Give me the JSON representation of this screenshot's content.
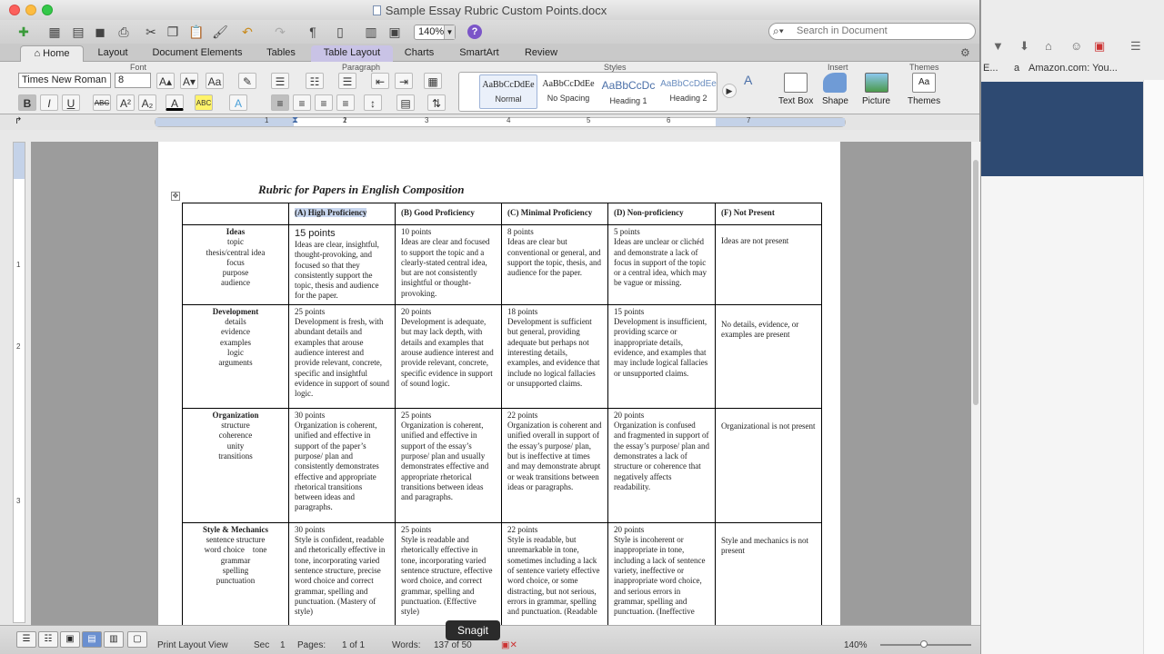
{
  "window": {
    "title": "Sample Essay Rubric Custom Points.docx"
  },
  "toolbar": {
    "zoom": "140%",
    "search_placeholder": "Search in Document"
  },
  "tabs": [
    "Home",
    "Layout",
    "Document Elements",
    "Tables",
    "Table Layout",
    "Charts",
    "SmartArt",
    "Review"
  ],
  "ribbon": {
    "groups": {
      "font": "Font",
      "paragraph": "Paragraph",
      "styles": "Styles",
      "insert": "Insert",
      "themes": "Themes"
    },
    "font_name": "Times New Roman",
    "font_size": "8",
    "styles": [
      {
        "preview": "AaBbCcDdEe",
        "name": "Normal"
      },
      {
        "preview": "AaBbCcDdEe",
        "name": "No Spacing"
      },
      {
        "preview": "AaBbCcDc",
        "name": "Heading 1"
      },
      {
        "preview": "AaBbCcDdEe",
        "name": "Heading 2"
      }
    ],
    "insert_items": [
      "Text Box",
      "Shape",
      "Picture"
    ],
    "themes_label": "Themes"
  },
  "ruler": {
    "numbers": [
      "1",
      "1",
      "2",
      "3",
      "4",
      "5",
      "6",
      "7"
    ],
    "vnumbers": [
      "1",
      "2",
      "3"
    ]
  },
  "browser": {
    "bookmark": "E...",
    "amazon": "Amazon.com: You..."
  },
  "document": {
    "title": "Rubric for Papers in English Composition",
    "headers": [
      "",
      "(A) High Proficiency",
      "(B) Good Proficiency",
      "(C) Minimal Proficiency",
      "(D) Non-proficiency",
      "(F) Not Present"
    ],
    "rows": [
      {
        "criterion": "Ideas",
        "subs": [
          "topic",
          "thesis/central idea",
          "focus",
          "purpose",
          "audience"
        ],
        "cells": [
          {
            "points": "15 points",
            "text": "Ideas are clear, insightful, thought-provoking, and focused so that they consistently support the topic, thesis and audience for the paper."
          },
          {
            "points": "10 points",
            "text": "Ideas are clear and focused to support the topic and a clearly-stated central idea, but are not consistently insightful or thought-provoking."
          },
          {
            "points": "8 points",
            "text": "Ideas are clear but conventional or general, and support the topic, thesis, and audience for the paper."
          },
          {
            "points": "5 points",
            "text": "Ideas are unclear or clichéd and demonstrate a lack of focus in support of the topic or a central idea, which may be vague or missing."
          },
          {
            "points": "",
            "text": "Ideas are not present"
          }
        ]
      },
      {
        "criterion": "Development",
        "subs": [
          "details",
          "evidence",
          "examples",
          "logic",
          "arguments"
        ],
        "cells": [
          {
            "points": "25 points",
            "text": "Development is fresh, with abundant details and examples that arouse audience interest and provide relevant, concrete, specific and insightful evidence in support of sound logic."
          },
          {
            "points": "20 points",
            "text": "Development is adequate, but may lack depth, with details and examples that arouse audience interest and provide relevant, concrete, specific evidence in support of sound logic."
          },
          {
            "points": "18 points",
            "text": "Development is sufficient but general, providing adequate but perhaps not interesting details, examples, and evidence that include no logical fallacies or unsupported claims."
          },
          {
            "points": "15 points",
            "text": "Development is insufficient, providing scarce or inappropriate details, evidence, and examples that may include logical fallacies or unsupported claims."
          },
          {
            "points": "",
            "text": "No details, evidence, or examples are present"
          }
        ]
      },
      {
        "criterion": "Organization",
        "subs": [
          "structure",
          "coherence",
          "unity",
          "transitions"
        ],
        "cells": [
          {
            "points": "30 points",
            "text": "Organization is coherent, unified and effective in support of the paper’s purpose/ plan and consistently demonstrates effective and appropriate rhetorical transitions between ideas and paragraphs."
          },
          {
            "points": "25 points",
            "text": "Organization is coherent, unified and effective in support of the essay’s purpose/ plan and usually demonstrates effective and appropriate rhetorical transitions between ideas and paragraphs."
          },
          {
            "points": "22 points",
            "text": "Organization is coherent and unified overall in support of the essay’s purpose/ plan, but is ineffective at times and may demonstrate abrupt or weak transitions between ideas or paragraphs."
          },
          {
            "points": "20 points",
            "text": "Organization is confused and fragmented in support of the essay’s purpose/ plan and demonstrates a lack of structure or coherence that negatively affects readability."
          },
          {
            "points": "",
            "text": "Organizational is not present"
          }
        ]
      },
      {
        "criterion": "Style & Mechanics",
        "subs": [
          "sentence structure",
          "word choice    tone",
          "grammar",
          "spelling",
          "punctuation"
        ],
        "cells": [
          {
            "points": "30 points",
            "text": "Style is confident, readable and rhetorically effective in tone, incorporating varied sentence structure, precise word choice and correct grammar, spelling and punctuation. (Mastery of style)"
          },
          {
            "points": "25 points",
            "text": "Style is readable and rhetorically effective in tone, incorporating varied sentence structure, effective word choice, and correct grammar, spelling and punctuation. (Effective style)"
          },
          {
            "points": "22 points",
            "text": "Style is readable, but unremarkable in tone, sometimes including a lack of sentence variety effective word choice, or some distracting, but not serious, errors in grammar, spelling and punctuation. (Readable"
          },
          {
            "points": "20 points",
            "text": "Style is incoherent or inappropriate in tone, including a lack of sentence variety, ineffective or inappropriate word choice, and serious errors in grammar, spelling and punctuation. (Ineffective"
          },
          {
            "points": "",
            "text": "Style and mechanics is not present"
          }
        ]
      }
    ]
  },
  "status": {
    "view": "Print Layout View",
    "sec_label": "Sec",
    "sec": "1",
    "pages_label": "Pages:",
    "pages": "1 of 1",
    "words_label": "Words:",
    "words": "137 of 50",
    "zoom": "140%"
  },
  "snagit": "Snagit"
}
